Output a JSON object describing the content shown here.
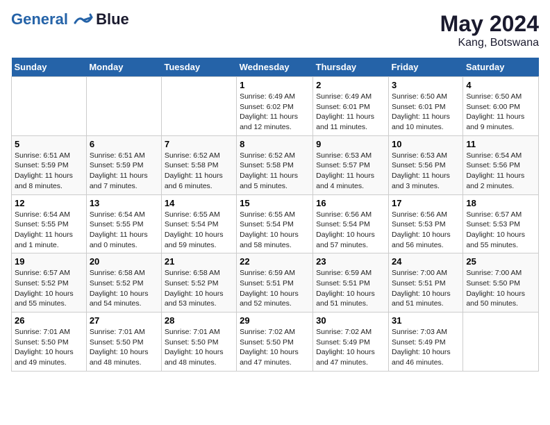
{
  "header": {
    "logo_line1": "General",
    "logo_line2": "Blue",
    "month_title": "May 2024",
    "location": "Kang, Botswana"
  },
  "weekdays": [
    "Sunday",
    "Monday",
    "Tuesday",
    "Wednesday",
    "Thursday",
    "Friday",
    "Saturday"
  ],
  "weeks": [
    [
      {
        "day": "",
        "info": ""
      },
      {
        "day": "",
        "info": ""
      },
      {
        "day": "",
        "info": ""
      },
      {
        "day": "1",
        "info": "Sunrise: 6:49 AM\nSunset: 6:02 PM\nDaylight: 11 hours and 12 minutes."
      },
      {
        "day": "2",
        "info": "Sunrise: 6:49 AM\nSunset: 6:01 PM\nDaylight: 11 hours and 11 minutes."
      },
      {
        "day": "3",
        "info": "Sunrise: 6:50 AM\nSunset: 6:01 PM\nDaylight: 11 hours and 10 minutes."
      },
      {
        "day": "4",
        "info": "Sunrise: 6:50 AM\nSunset: 6:00 PM\nDaylight: 11 hours and 9 minutes."
      }
    ],
    [
      {
        "day": "5",
        "info": "Sunrise: 6:51 AM\nSunset: 5:59 PM\nDaylight: 11 hours and 8 minutes."
      },
      {
        "day": "6",
        "info": "Sunrise: 6:51 AM\nSunset: 5:59 PM\nDaylight: 11 hours and 7 minutes."
      },
      {
        "day": "7",
        "info": "Sunrise: 6:52 AM\nSunset: 5:58 PM\nDaylight: 11 hours and 6 minutes."
      },
      {
        "day": "8",
        "info": "Sunrise: 6:52 AM\nSunset: 5:58 PM\nDaylight: 11 hours and 5 minutes."
      },
      {
        "day": "9",
        "info": "Sunrise: 6:53 AM\nSunset: 5:57 PM\nDaylight: 11 hours and 4 minutes."
      },
      {
        "day": "10",
        "info": "Sunrise: 6:53 AM\nSunset: 5:56 PM\nDaylight: 11 hours and 3 minutes."
      },
      {
        "day": "11",
        "info": "Sunrise: 6:54 AM\nSunset: 5:56 PM\nDaylight: 11 hours and 2 minutes."
      }
    ],
    [
      {
        "day": "12",
        "info": "Sunrise: 6:54 AM\nSunset: 5:55 PM\nDaylight: 11 hours and 1 minute."
      },
      {
        "day": "13",
        "info": "Sunrise: 6:54 AM\nSunset: 5:55 PM\nDaylight: 11 hours and 0 minutes."
      },
      {
        "day": "14",
        "info": "Sunrise: 6:55 AM\nSunset: 5:54 PM\nDaylight: 10 hours and 59 minutes."
      },
      {
        "day": "15",
        "info": "Sunrise: 6:55 AM\nSunset: 5:54 PM\nDaylight: 10 hours and 58 minutes."
      },
      {
        "day": "16",
        "info": "Sunrise: 6:56 AM\nSunset: 5:54 PM\nDaylight: 10 hours and 57 minutes."
      },
      {
        "day": "17",
        "info": "Sunrise: 6:56 AM\nSunset: 5:53 PM\nDaylight: 10 hours and 56 minutes."
      },
      {
        "day": "18",
        "info": "Sunrise: 6:57 AM\nSunset: 5:53 PM\nDaylight: 10 hours and 55 minutes."
      }
    ],
    [
      {
        "day": "19",
        "info": "Sunrise: 6:57 AM\nSunset: 5:52 PM\nDaylight: 10 hours and 55 minutes."
      },
      {
        "day": "20",
        "info": "Sunrise: 6:58 AM\nSunset: 5:52 PM\nDaylight: 10 hours and 54 minutes."
      },
      {
        "day": "21",
        "info": "Sunrise: 6:58 AM\nSunset: 5:52 PM\nDaylight: 10 hours and 53 minutes."
      },
      {
        "day": "22",
        "info": "Sunrise: 6:59 AM\nSunset: 5:51 PM\nDaylight: 10 hours and 52 minutes."
      },
      {
        "day": "23",
        "info": "Sunrise: 6:59 AM\nSunset: 5:51 PM\nDaylight: 10 hours and 51 minutes."
      },
      {
        "day": "24",
        "info": "Sunrise: 7:00 AM\nSunset: 5:51 PM\nDaylight: 10 hours and 51 minutes."
      },
      {
        "day": "25",
        "info": "Sunrise: 7:00 AM\nSunset: 5:50 PM\nDaylight: 10 hours and 50 minutes."
      }
    ],
    [
      {
        "day": "26",
        "info": "Sunrise: 7:01 AM\nSunset: 5:50 PM\nDaylight: 10 hours and 49 minutes."
      },
      {
        "day": "27",
        "info": "Sunrise: 7:01 AM\nSunset: 5:50 PM\nDaylight: 10 hours and 48 minutes."
      },
      {
        "day": "28",
        "info": "Sunrise: 7:01 AM\nSunset: 5:50 PM\nDaylight: 10 hours and 48 minutes."
      },
      {
        "day": "29",
        "info": "Sunrise: 7:02 AM\nSunset: 5:50 PM\nDaylight: 10 hours and 47 minutes."
      },
      {
        "day": "30",
        "info": "Sunrise: 7:02 AM\nSunset: 5:49 PM\nDaylight: 10 hours and 47 minutes."
      },
      {
        "day": "31",
        "info": "Sunrise: 7:03 AM\nSunset: 5:49 PM\nDaylight: 10 hours and 46 minutes."
      },
      {
        "day": "",
        "info": ""
      }
    ]
  ]
}
